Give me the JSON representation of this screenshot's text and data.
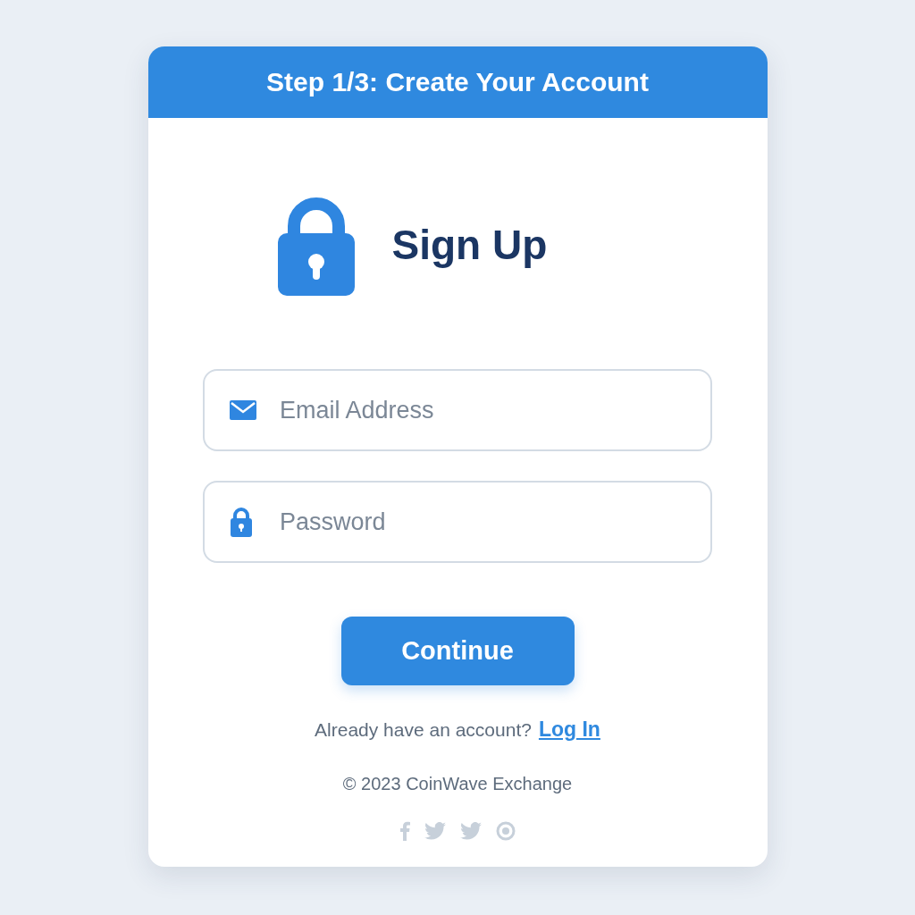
{
  "header": {
    "title": "Step 1/3: Create Your Account"
  },
  "heading": "Sign Up",
  "fields": [
    {
      "kind": "email",
      "placeholder": "Email Address"
    },
    {
      "kind": "password",
      "placeholder": "Password"
    }
  ],
  "button": "Continue",
  "login_prompt": {
    "text": "Already have an account?",
    "link": "Log In"
  },
  "footer": "© 2023 CoinWave Exchange"
}
